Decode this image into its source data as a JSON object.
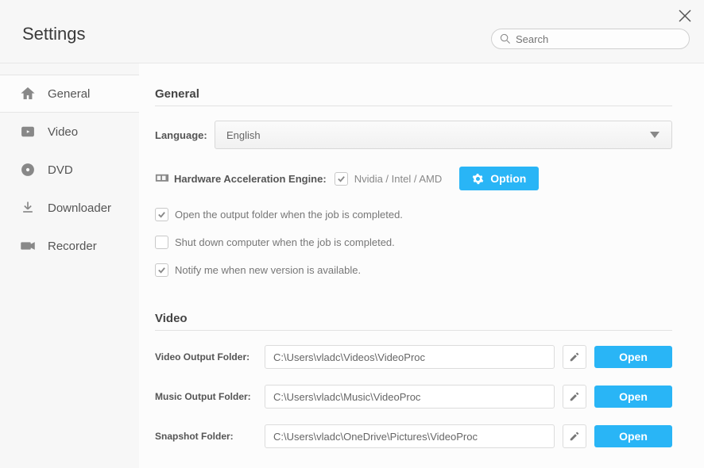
{
  "window": {
    "title": "Settings",
    "search_placeholder": "Search"
  },
  "sidebar": {
    "items": [
      {
        "label": "General"
      },
      {
        "label": "Video"
      },
      {
        "label": "DVD"
      },
      {
        "label": "Downloader"
      },
      {
        "label": "Recorder"
      }
    ]
  },
  "sections": {
    "general": {
      "heading": "General",
      "language_label": "Language:",
      "language_value": "English",
      "hw_label": "Hardware Acceleration Engine:",
      "hw_vendors": "Nvidia / Intel / AMD",
      "option_button": "Option",
      "checks": {
        "open_output": "Open the output folder when the job is completed.",
        "shutdown": "Shut down computer when the job is completed.",
        "notify": "Notify me when new version is available."
      }
    },
    "video": {
      "heading": "Video",
      "rows": [
        {
          "label": "Video Output Folder:",
          "path": "C:\\Users\\vladc\\Videos\\VideoProc"
        },
        {
          "label": "Music Output Folder:",
          "path": "C:\\Users\\vladc\\Music\\VideoProc"
        },
        {
          "label": "Snapshot Folder:",
          "path": "C:\\Users\\vladc\\OneDrive\\Pictures\\VideoProc"
        }
      ],
      "open_button": "Open"
    }
  }
}
